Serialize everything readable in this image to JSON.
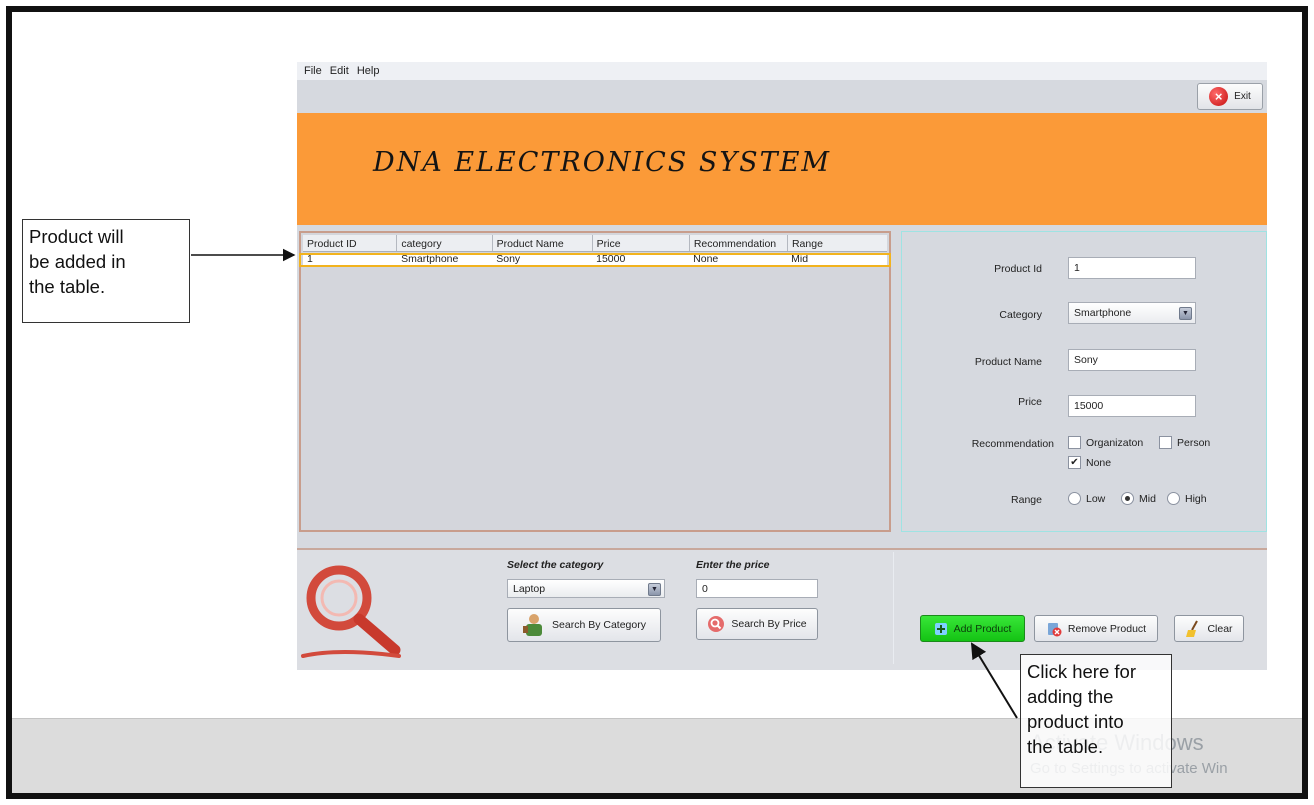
{
  "menu": {
    "file": "File",
    "edit": "Edit",
    "help": "Help"
  },
  "toolbar": {
    "exit_label": "Exit"
  },
  "banner": {
    "title": "DNA ELECTRONICS SYSTEM",
    "color": "#fb9a38"
  },
  "table": {
    "columns": [
      "Product ID",
      "category",
      "Product Name",
      "Price",
      "Recommendation",
      "Range"
    ],
    "rows": [
      [
        "1",
        "Smartphone",
        "Sony",
        "15000",
        "None",
        "Mid"
      ]
    ]
  },
  "form": {
    "product_id": {
      "label": "Product Id",
      "value": "1"
    },
    "category": {
      "label": "Category",
      "value": "Smartphone"
    },
    "product_name": {
      "label": "Product Name",
      "value": "Sony"
    },
    "price": {
      "label": "Price",
      "value": "15000"
    },
    "recommendation": {
      "label": "Recommendation",
      "options": [
        {
          "label": "Organizaton",
          "checked": false
        },
        {
          "label": "Person",
          "checked": false
        },
        {
          "label": "None",
          "checked": true
        }
      ]
    },
    "range": {
      "label": "Range",
      "options": [
        {
          "label": "Low",
          "selected": false
        },
        {
          "label": "Mid",
          "selected": true
        },
        {
          "label": "High",
          "selected": false
        }
      ]
    }
  },
  "search": {
    "category_caption": "Select the category",
    "category_value": "Laptop",
    "price_caption": "Enter the price",
    "price_value": "0",
    "search_category_label": "Search By Category",
    "search_price_label": "Search By Price"
  },
  "actions": {
    "add_label": "Add Product",
    "remove_label": "Remove Product",
    "clear_label": "Clear",
    "add_color": "#22d422"
  },
  "annotations": {
    "left_callout": [
      "Product will",
      "be added in",
      "the table."
    ],
    "right_callout": [
      "Click here for",
      "adding the",
      "product into",
      "the table."
    ],
    "watermark_line1": "Activate Windows",
    "watermark_line2": "Go to Settings to activate Win"
  }
}
